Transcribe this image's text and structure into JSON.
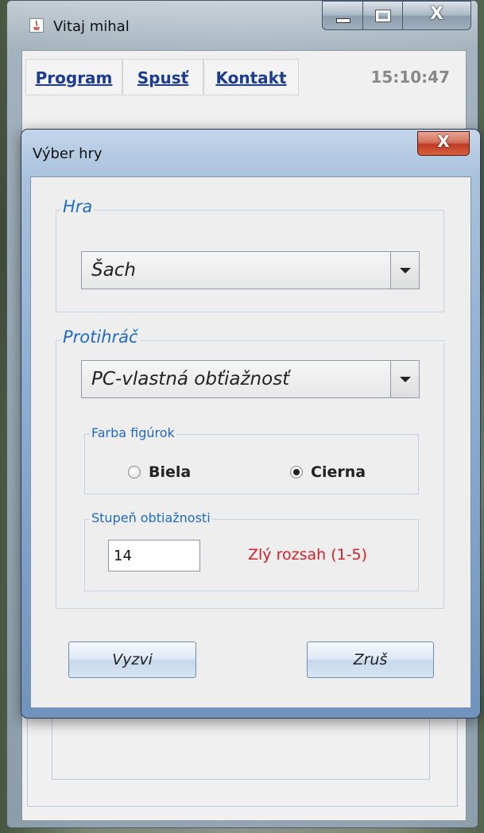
{
  "main_window": {
    "title": "Vitaj mihal",
    "caption_buttons": {
      "close": "X"
    },
    "menu": [
      {
        "label": "Program",
        "id": "program"
      },
      {
        "label": "Spusť",
        "id": "spust"
      },
      {
        "label": "Kontakt",
        "id": "kontakt"
      }
    ],
    "clock": "15:10:47"
  },
  "dialog": {
    "title": "Výber hry",
    "close": "X",
    "game_group": {
      "legend": "Hra",
      "selected": "Šach"
    },
    "opponent_group": {
      "legend": "Protihráč",
      "selected": "PC-vlastná obťiažnosť",
      "color_group": {
        "legend": "Farba figúrok",
        "options": [
          {
            "label": "Biela",
            "checked": false
          },
          {
            "label": "Cierna",
            "checked": true
          }
        ]
      },
      "difficulty_group": {
        "legend": "Stupeň obtiažnosti",
        "value": "14",
        "error": "Zlý rozsah (1-5)"
      }
    },
    "buttons": {
      "challenge": "Vyzvi",
      "cancel": "Zruš"
    }
  },
  "colors": {
    "link_blue": "#1d3b8f",
    "legend_blue": "#1f6bc4",
    "error_red": "#d0202a"
  }
}
